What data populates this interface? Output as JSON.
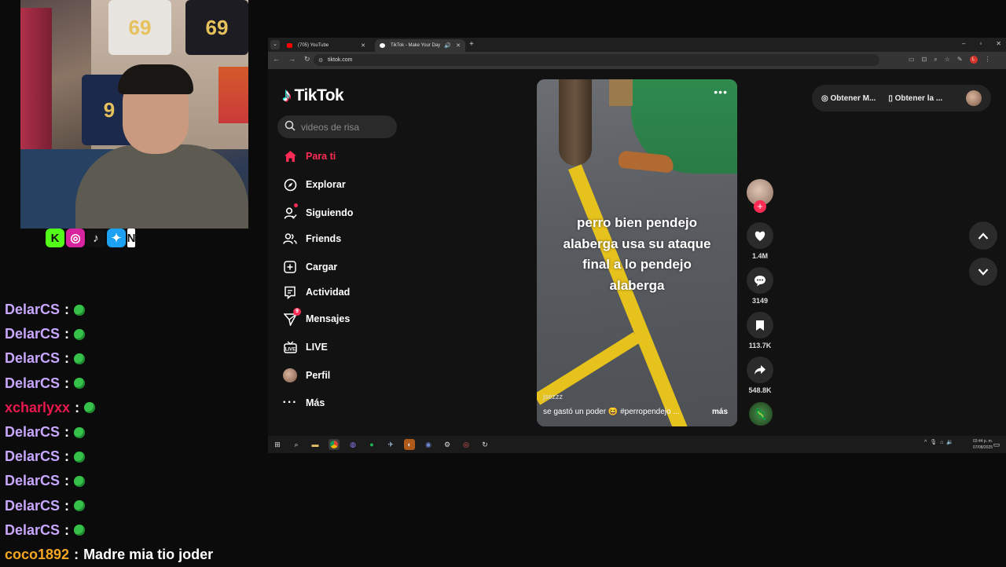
{
  "social_icons": [
    {
      "icon": "kick-icon",
      "glyph": "K",
      "color": "#53fc18"
    },
    {
      "icon": "instagram-icon",
      "glyph": "◎",
      "color": "#d6249f"
    },
    {
      "icon": "tiktok-icon",
      "glyph": "♪",
      "color": "#111111"
    },
    {
      "icon": "twitter-icon",
      "glyph": "✦",
      "color": "#1da1f2"
    }
  ],
  "chat": [
    {
      "user": "DelarCS",
      "color": "#c8a7ff",
      "msg": ""
    },
    {
      "user": "DelarCS",
      "color": "#c8a7ff",
      "msg": ""
    },
    {
      "user": "DelarCS",
      "color": "#c8a7ff",
      "msg": ""
    },
    {
      "user": "DelarCS",
      "color": "#c8a7ff",
      "msg": ""
    },
    {
      "user": "xcharlyxx",
      "color": "#e8194f",
      "msg": ""
    },
    {
      "user": "DelarCS",
      "color": "#c8a7ff",
      "msg": ""
    },
    {
      "user": "DelarCS",
      "color": "#c8a7ff",
      "msg": ""
    },
    {
      "user": "DelarCS",
      "color": "#c8a7ff",
      "msg": ""
    },
    {
      "user": "DelarCS",
      "color": "#c8a7ff",
      "msg": ""
    },
    {
      "user": "DelarCS",
      "color": "#c8a7ff",
      "msg": ""
    },
    {
      "user": "coco1892",
      "color": "#f5a623",
      "msg": "Madre mia tio joder"
    }
  ],
  "browser": {
    "tab1": "(705) YouTube",
    "tab2": "TikTok - Make Your Day",
    "url": "tiktok.com"
  },
  "tiktok": {
    "brand": "TikTok",
    "search_placeholder": "videos de risa",
    "nav": {
      "para_ti": "Para ti",
      "explorar": "Explorar",
      "siguiendo": "Siguiendo",
      "friends": "Friends",
      "cargar": "Cargar",
      "actividad": "Actividad",
      "mensajes": "Mensajes",
      "mensajes_badge": "9",
      "live": "LIVE",
      "perfil": "Perfil",
      "mas": "Más"
    },
    "video": {
      "caption_lines": [
        "perro bien pendejo",
        "alaberga usa su ataque",
        "final a lo pendejo",
        "alaberga"
      ],
      "author": "jsezzz",
      "description": "se gastó un poder 😆 #perropendejo ...",
      "more": "más"
    },
    "actions": {
      "likes": "1.4M",
      "comments": "3149",
      "saves": "113.7K",
      "shares": "548.8K"
    },
    "get_app": {
      "b1": "Obtener M...",
      "b2": "Obtener la ..."
    }
  },
  "taskbar": {
    "time": "03:44 p. m.",
    "date": "07/08/2025"
  }
}
